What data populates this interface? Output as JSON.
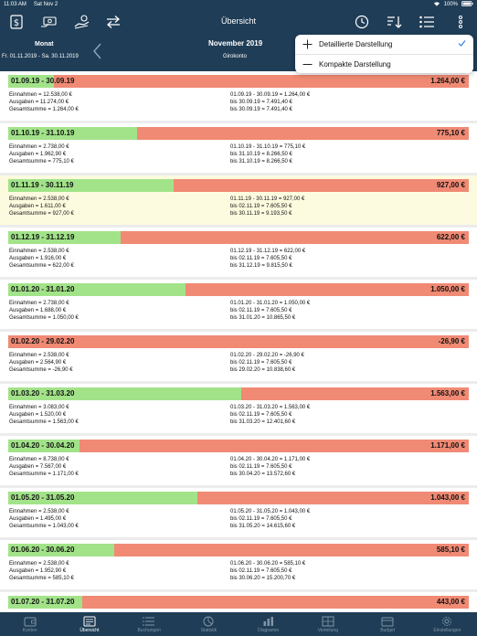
{
  "status": {
    "time": "11:03 AM",
    "date": "Sat Nov 2",
    "battery": "100%"
  },
  "nav": {
    "title": "Übersicht"
  },
  "header": {
    "month_label": "Monat",
    "range": "Fr. 01.11.2019 - Sa. 30.11.2019",
    "period": "November 2019",
    "account": "Girokonto"
  },
  "popover": {
    "items": [
      {
        "label": "Detaillierte Darstellung",
        "checked": true
      },
      {
        "label": "Kompakte Darstellung",
        "checked": false
      }
    ]
  },
  "periods": [
    {
      "label": "01.09.19 - 30.09.19",
      "total": "1.264,00 €",
      "income": "Einnahmen = 12.538,00 €",
      "expenses": "Ausgaben = 11.274,00 €",
      "sum": "Gesamtsumme = 1.264,00 €",
      "range_sum": "01.09.19 - 30.09.19 = 1.264,00 €",
      "until1": "bis 30.09.19 = 7.491,40 €",
      "until2": "bis 30.09.19 = 7.491,40 €",
      "income_ratio": 0.1,
      "current": false
    },
    {
      "label": "01.10.19 - 31.10.19",
      "total": "775,10 €",
      "income": "Einnahmen = 2.738,00 €",
      "expenses": "Ausgaben = 1.962,90 €",
      "sum": "Gesamtsumme = 775,10 €",
      "range_sum": "01.10.19 - 31.10.19 = 775,10 €",
      "until1": "bis 31.10.19 = 8.266,50 €",
      "until2": "bis 31.10.19 = 8.266,50 €",
      "income_ratio": 0.28,
      "current": false
    },
    {
      "label": "01.11.19 - 30.11.19",
      "total": "927,00 €",
      "income": "Einnahmen = 2.538,00 €",
      "expenses": "Ausgaben = 1.611,00 €",
      "sum": "Gesamtsumme = 927,00 €",
      "range_sum": "01.11.19 - 30.11.19 = 927,00 €",
      "until1": "bis 02.11.19 = 7.605,50 €",
      "until2": "bis 30.11.19 = 9.193,50 €",
      "income_ratio": 0.36,
      "current": true
    },
    {
      "label": "01.12.19 - 31.12.19",
      "total": "622,00 €",
      "income": "Einnahmen = 2.538,00 €",
      "expenses": "Ausgaben = 1.916,00 €",
      "sum": "Gesamtsumme = 622,00 €",
      "range_sum": "01.12.19 - 31.12.19 = 622,00 €",
      "until1": "bis 02.11.19 = 7.605,50 €",
      "until2": "bis 31.12.19 = 9.815,50 €",
      "income_ratio": 0.245,
      "current": false
    },
    {
      "label": "01.01.20 - 31.01.20",
      "total": "1.050,00 €",
      "income": "Einnahmen = 2.738,00 €",
      "expenses": "Ausgaben = 1.688,00 €",
      "sum": "Gesamtsumme = 1.050,00 €",
      "range_sum": "01.01.20 - 31.01.20 = 1.050,00 €",
      "until1": "bis 02.11.19 = 7.605,50 €",
      "until2": "bis 31.01.20 = 10.865,50 €",
      "income_ratio": 0.385,
      "current": false
    },
    {
      "label": "01.02.20 - 29.02.20",
      "total": "-26,90 €",
      "income": "Einnahmen = 2.538,00 €",
      "expenses": "Ausgaben = 2.564,90 €",
      "sum": "Gesamtsumme = -26,90 €",
      "range_sum": "01.02.20 - 29.02.20 = -26,90 €",
      "until1": "bis 02.11.19 = 7.605,50 €",
      "until2": "bis 29.02.20 = 10.838,60 €",
      "income_ratio": 0.0,
      "current": false
    },
    {
      "label": "01.03.20 - 31.03.20",
      "total": "1.563,00 €",
      "income": "Einnahmen = 3.083,00 €",
      "expenses": "Ausgaben = 1.520,00 €",
      "sum": "Gesamtsumme = 1.563,00 €",
      "range_sum": "01.03.20 - 31.03.20 = 1.563,00 €",
      "until1": "bis 02.11.19 = 7.605,50 €",
      "until2": "bis 31.03.20 = 12.401,60 €",
      "income_ratio": 0.505,
      "current": false
    },
    {
      "label": "01.04.20 - 30.04.20",
      "total": "1.171,00 €",
      "income": "Einnahmen = 8.738,00 €",
      "expenses": "Ausgaben = 7.567,00 €",
      "sum": "Gesamtsumme = 1.171,00 €",
      "range_sum": "01.04.20 - 30.04.20 = 1.171,00 €",
      "until1": "bis 02.11.19 = 7.605,50 €",
      "until2": "bis 30.04.20 = 13.572,60 €",
      "income_ratio": 0.155,
      "current": false
    },
    {
      "label": "01.05.20 - 31.05.20",
      "total": "1.043,00 €",
      "income": "Einnahmen = 2.538,00 €",
      "expenses": "Ausgaben = 1.495,00 €",
      "sum": "Gesamtsumme = 1.043,00 €",
      "range_sum": "01.05.20 - 31.05.20 = 1.043,00 €",
      "until1": "bis 02.11.19 = 7.605,50 €",
      "until2": "bis 31.05.20 = 14.615,60 €",
      "income_ratio": 0.41,
      "current": false
    },
    {
      "label": "01.06.20 - 30.06.20",
      "total": "585,10 €",
      "income": "Einnahmen = 2.538,00 €",
      "expenses": "Ausgaben = 1.952,90 €",
      "sum": "Gesamtsumme = 585,10 €",
      "range_sum": "01.06.20 - 30.06.20 = 585,10 €",
      "until1": "bis 02.11.19 = 7.605,50 €",
      "until2": "bis 30.06.20 = 15.200,70 €",
      "income_ratio": 0.23,
      "current": false
    },
    {
      "label": "01.07.20 - 31.07.20",
      "total": "443,00 €",
      "income": "Einnahmen = 2.738,00 €",
      "expenses": "",
      "sum": "",
      "range_sum": "01.07.20 - 31.07.20 = 443,00 €",
      "until1": "",
      "until2": "",
      "income_ratio": 0.16,
      "current": false
    }
  ],
  "tabs": [
    {
      "label": "Konten",
      "icon": "wallet-icon",
      "active": false
    },
    {
      "label": "Übersicht",
      "icon": "overview-icon",
      "active": true
    },
    {
      "label": "Buchungen",
      "icon": "list-icon",
      "active": false
    },
    {
      "label": "Statistik",
      "icon": "pie-icon",
      "active": false
    },
    {
      "label": "Diagramm",
      "icon": "bar-chart-icon",
      "active": false
    },
    {
      "label": "Verteilung",
      "icon": "distribution-icon",
      "active": false
    },
    {
      "label": "Budget",
      "icon": "budget-icon",
      "active": false
    },
    {
      "label": "Einstellungen",
      "icon": "gear-icon",
      "active": false
    }
  ]
}
